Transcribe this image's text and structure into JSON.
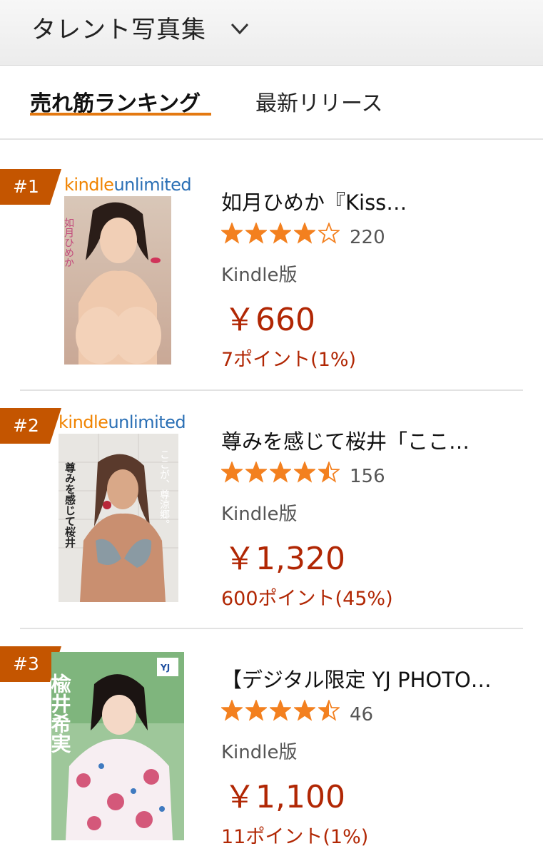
{
  "header": {
    "title": "タレント写真集",
    "dropdown_icon": "chevron-down-icon"
  },
  "tabs": [
    {
      "label": "売れ筋ランキング",
      "active": true
    },
    {
      "label": "最新リリース",
      "active": false
    }
  ],
  "colors": {
    "accent": "#e47911",
    "price": "#b12704",
    "star": "#f3801f",
    "badge": "#c45500"
  },
  "kindle_unlimited": {
    "part1": "kindle",
    "part2": "unlimited"
  },
  "products": [
    {
      "rank": "#1",
      "title": "如月ひめか『Kiss…",
      "rating": 4,
      "review_count": "220",
      "format": "Kindle版",
      "price": "￥660",
      "points": "7ポイント(1%)"
    },
    {
      "rank": "#2",
      "title": "尊みを感じて桜井「ここ…",
      "rating": 4.5,
      "review_count": "156",
      "format": "Kindle版",
      "price": "￥1,320",
      "points": "600ポイント(45%)",
      "cover_text": {
        "left": "尊みを感じて桜井",
        "right": "ここが、尊涼郷。"
      }
    },
    {
      "rank": "#3",
      "title": "【デジタル限定 YJ PHOTO…",
      "rating": 4.5,
      "review_count": "46",
      "format": "Kindle版",
      "price": "￥1,100",
      "points": "11ポイント(1%)",
      "cover_text": {
        "name": "楡井希実"
      }
    }
  ]
}
